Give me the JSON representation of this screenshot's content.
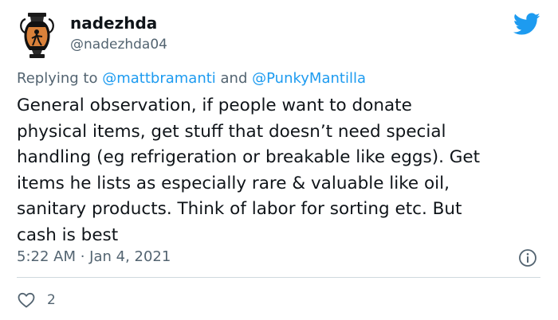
{
  "user": {
    "display_name": "nadezhda",
    "handle": "@nadezhda04",
    "avatar_icon": "greek-amphora-avatar"
  },
  "brand_icon": "twitter-bird-icon",
  "brand_color": "#1d9bf0",
  "reply": {
    "prefix": "Replying to",
    "mention_1": "@mattbramanti",
    "joiner": "and",
    "mention_2": "@PunkyMantilla"
  },
  "tweet_lines": [
    "General observation, if people want to donate",
    "physical items, get stuff that doesn’t need special",
    "handling (eg refrigeration or breakable like eggs). Get",
    "items he lists as especially rare & valuable like oil,",
    "sanitary products. Think of labor for sorting etc. But",
    "cash is best"
  ],
  "timestamp": "5:22 AM · Jan 4, 2021",
  "info_icon": "info-icon",
  "likes": {
    "icon": "heart-icon",
    "count": "2"
  }
}
